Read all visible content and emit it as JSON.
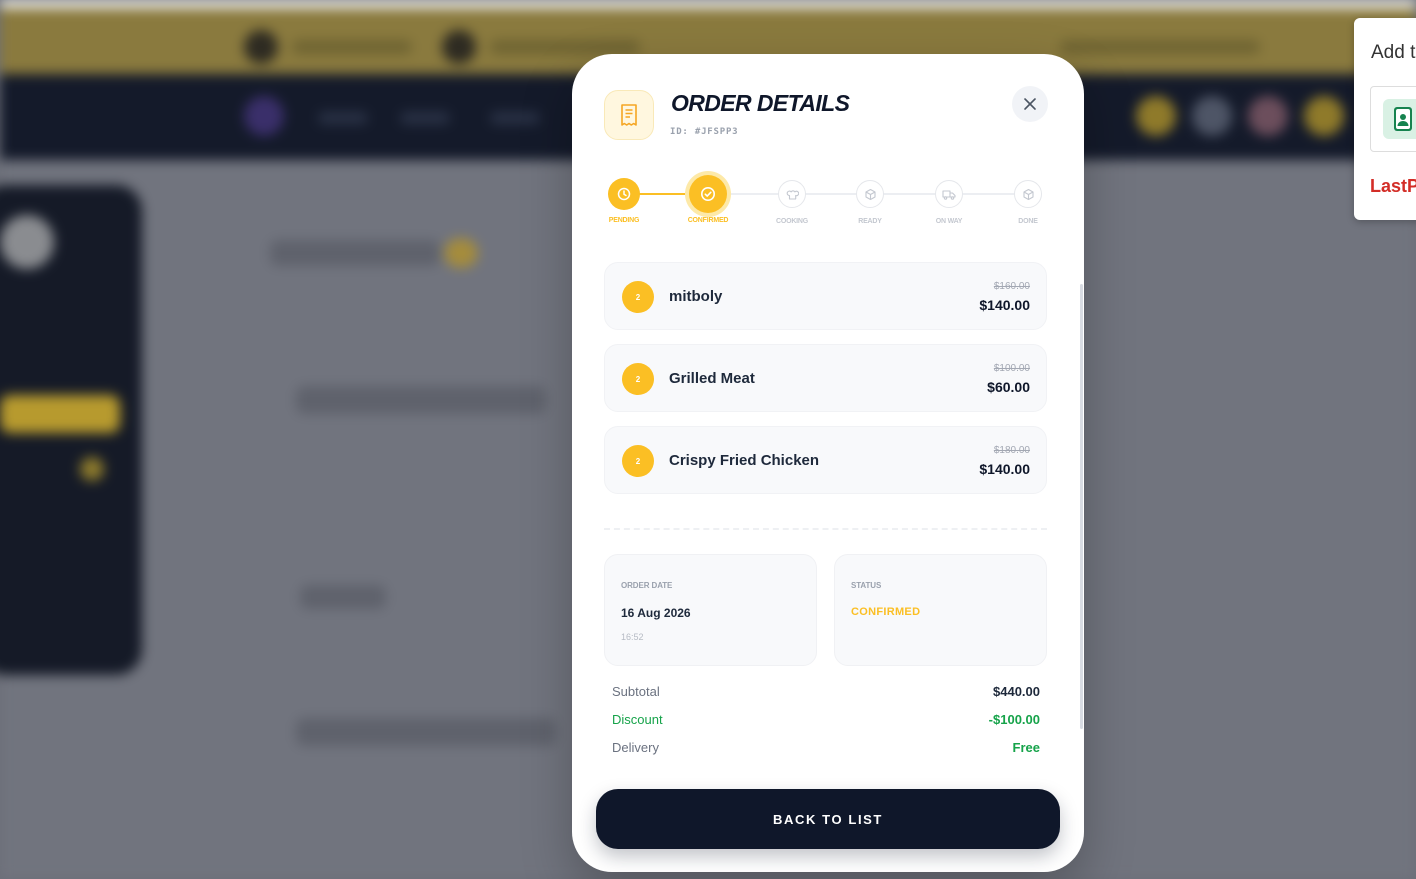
{
  "modal": {
    "title": "ORDER DETAILS",
    "order_id": "ID: #JFSPP3",
    "back_button": "BACK TO LIST"
  },
  "steps": [
    {
      "label": "PENDING",
      "state": "done",
      "icon": "clock-icon"
    },
    {
      "label": "CONFIRMED",
      "state": "current",
      "icon": "check-circle-icon"
    },
    {
      "label": "COOKING",
      "state": "todo",
      "icon": "chef-hat-icon"
    },
    {
      "label": "READY",
      "state": "todo",
      "icon": "box-icon"
    },
    {
      "label": "ON WAY",
      "state": "todo",
      "icon": "truck-icon"
    },
    {
      "label": "DONE",
      "state": "todo",
      "icon": "box-icon"
    }
  ],
  "items": [
    {
      "qty": "2",
      "name": "mitboly",
      "old_price": "$160.00",
      "price": "$140.00"
    },
    {
      "qty": "2",
      "name": "Grilled Meat",
      "old_price": "$100.00",
      "price": "$60.00"
    },
    {
      "qty": "2",
      "name": "Crispy Fried Chicken",
      "old_price": "$180.00",
      "price": "$140.00"
    }
  ],
  "order_date": {
    "label": "ORDER DATE",
    "date": "16 Aug 2026",
    "time": "16:52"
  },
  "status": {
    "label": "STATUS",
    "value": "CONFIRMED"
  },
  "summary": {
    "subtotal_label": "Subtotal",
    "subtotal": "$440.00",
    "discount_label": "Discount",
    "discount": "-$100.00",
    "delivery_label": "Delivery",
    "delivery": "Free"
  },
  "extension": {
    "title": "Add t",
    "brand": "LastP"
  },
  "colors": {
    "accent": "#fbbf24",
    "dark": "#0f172a",
    "green": "#16a34a"
  }
}
